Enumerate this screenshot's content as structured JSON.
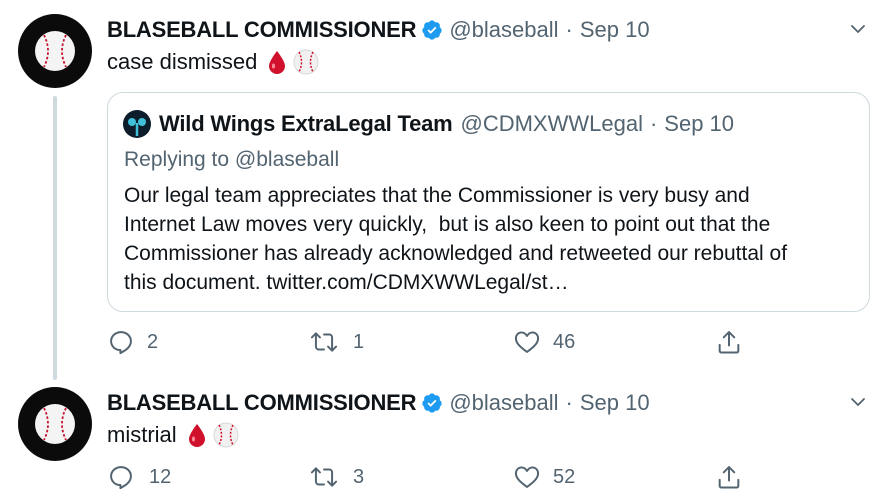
{
  "tweets": [
    {
      "display_name": "BLASEBALL COMMISSIONER",
      "handle": "@blaseball",
      "separator": "·",
      "date": "Sep 10",
      "text": "case dismissed",
      "replies": "2",
      "retweets": "1",
      "likes": "46"
    },
    {
      "display_name": "BLASEBALL COMMISSIONER",
      "handle": "@blaseball",
      "separator": "·",
      "date": "Sep 10",
      "text": "mistrial",
      "replies": "12",
      "retweets": "3",
      "likes": "52"
    }
  ],
  "quote": {
    "display_name": "Wild Wings ExtraLegal Team",
    "handle": "@CDMXWWLegal",
    "separator": "·",
    "date": "Sep 10",
    "replying_label": "Replying to",
    "replying_handle": "@blaseball",
    "lines": [
      "Our legal team appreciates that the Commissioner is very busy and",
      "Internet Law moves very quickly,  but is also keen to point out that the",
      "Commissioner has already acknowledged and retweeted our rebuttal of",
      "this document. twitter.com/CDMXWWLegal/st…"
    ]
  },
  "icons": {
    "verified": "verified-badge-icon",
    "blood_drop": "drop-of-blood-emoji",
    "baseball": "baseball-emoji",
    "reply": "reply-icon",
    "retweet": "retweet-icon",
    "like": "heart-icon",
    "share": "share-icon",
    "more": "chevron-down-icon"
  },
  "colors": {
    "text": "#0f1419",
    "secondary": "#536471",
    "verified": "#1d9bf0",
    "blood": "#d1102b",
    "thread_line": "#cfd9de"
  }
}
